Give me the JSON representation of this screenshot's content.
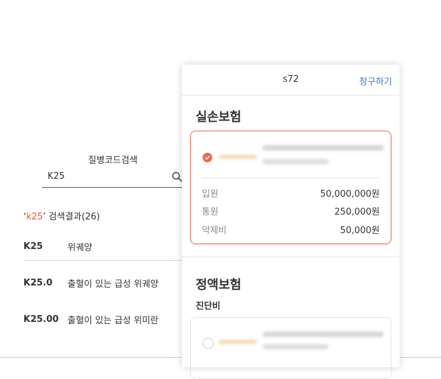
{
  "search": {
    "title": "질병코드검색",
    "query": "K25",
    "result_keyword": "k25",
    "result_caption_suffix": "’ 검색결과(26)",
    "result_caption_prefix": "‘",
    "results": [
      {
        "code": "K25",
        "name": "위궤양"
      },
      {
        "code": "K25.0",
        "name": "출혈이 있는 급성 위궤양"
      },
      {
        "code": "K25.00",
        "name": "출혈이 있는 급성 위미란"
      }
    ]
  },
  "panel": {
    "title": "s72",
    "claim_label": "청구하기",
    "indemnity": {
      "title": "실손보험",
      "amounts": [
        {
          "label": "입원",
          "value": "50,000,000원"
        },
        {
          "label": "통원",
          "value": "250,000원"
        },
        {
          "label": "약제비",
          "value": "50,000원"
        }
      ]
    },
    "fixed": {
      "title": "정액보험",
      "subtitle": "진단비"
    }
  },
  "colors": {
    "accent": "#ea6a55",
    "link": "#3a79c4"
  }
}
